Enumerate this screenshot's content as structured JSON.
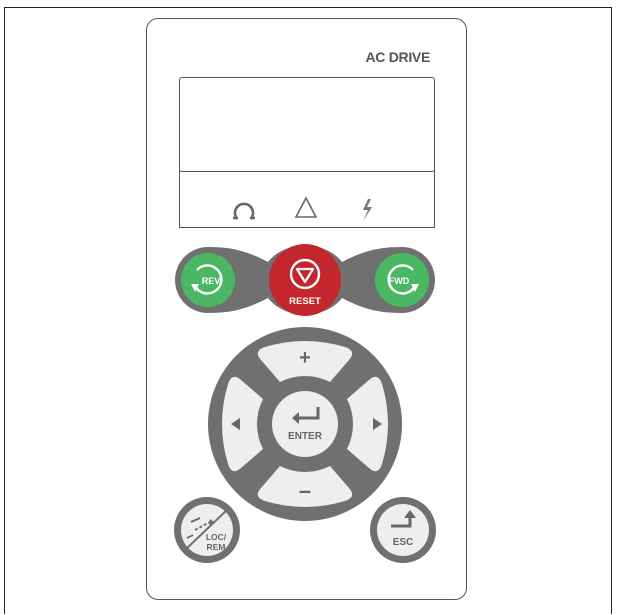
{
  "panel": {
    "brand": "AC DRIVE"
  },
  "indicators": [
    {
      "name": "run-indicator",
      "icon": "omega-icon"
    },
    {
      "name": "alarm-indicator",
      "icon": "triangle-icon"
    },
    {
      "name": "fault-indicator",
      "icon": "lightning-icon"
    }
  ],
  "buttons": {
    "rev": "REV",
    "reset": "RESET",
    "fwd": "FWD",
    "up": "+",
    "down": "–",
    "enter": "ENTER",
    "loc_rem": "LOC/ REM",
    "loc": "LOC/",
    "rem": "REM",
    "esc": "ESC"
  },
  "colors": {
    "green": "#4bb764",
    "red": "#c4262d",
    "keypad_ring": "#707070",
    "keypad_button": "#eeeeee"
  }
}
